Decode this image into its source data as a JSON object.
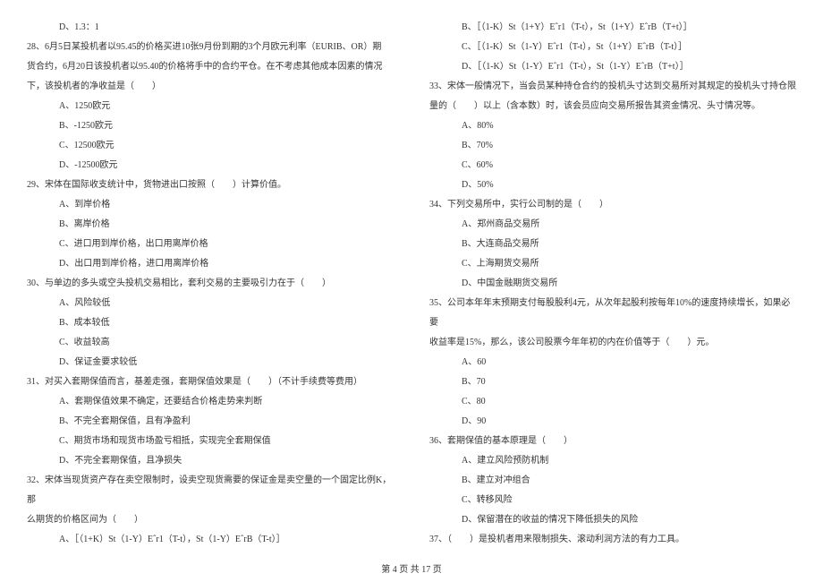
{
  "left_column": {
    "q27_d": "D、1.3：1",
    "q28_line1": "28、6月5日某投机者以95.45的价格买进10张9月份到期的3个月欧元利率（EURIB、OR）期",
    "q28_line2": "货合约，6月20日该投机者以95.40的价格将手中的合约平仓。在不考虑其他成本因素的情况",
    "q28_line3": "下，该投机者的净收益是（　　）",
    "q28_a": "A、1250欧元",
    "q28_b": "B、-1250欧元",
    "q28_c": "C、12500欧元",
    "q28_d": "D、-12500欧元",
    "q29": "29、宋体在国际收支统计中，货物进出口按照（　　）计算价值。",
    "q29_a": "A、到岸价格",
    "q29_b": "B、离岸价格",
    "q29_c": "C、进口用到岸价格，出口用离岸价格",
    "q29_d": "D、出口用到岸价格，进口用离岸价格",
    "q30": "30、与单边的多头或空头投机交易相比，套利交易的主要吸引力在于（　　）",
    "q30_a": "A、风险较低",
    "q30_b": "B、成本较低",
    "q30_c": "C、收益较高",
    "q30_d": "D、保证金要求较低",
    "q31": "31、对买入套期保值而言，基差走强，套期保值效果是（　　）（不计手续费等费用）",
    "q31_a": "A、套期保值效果不确定，还要结合价格走势来判断",
    "q31_b": "B、不完全套期保值，且有净盈利",
    "q31_c": "C、期货市场和现货市场盈亏相抵，实现完全套期保值",
    "q31_d": "D、不完全套期保值，且净损失",
    "q32_line1": "32、宋体当现货资产存在卖空限制时，设卖空现货需要的保证金是卖空量的一个固定比例K，那",
    "q32_line2": "么期货的价格区间为（　　）",
    "q32_a": "A、［（1+K）St（1-Y）Eˆr1（T-t），St（1-Y）EˆrB（T-t）］"
  },
  "right_column": {
    "q32_b": "B、［（1-K）St（1+Y）Eˆr1（T-t），St（1+Y）EˆrB（T+t）］",
    "q32_c": "C、［（1-K）St（1-Y）Eˆr1（T-t），St（1+Y）EˆrB（T-t）］",
    "q32_d": "D、［（1-K）St（1-Y）Eˆr1（T-t），St（1-Y）EˆrB（T+t）］",
    "q33_line1": "33、宋体一般情况下，当会员某种持仓合约的投机头寸达到交易所对其规定的投机头寸持仓限",
    "q33_line2": "量的（　　）以上（含本数）时，该会员应向交易所报告其资金情况、头寸情况等。",
    "q33_a": "A、80%",
    "q33_b": "B、70%",
    "q33_c": "C、60%",
    "q33_d": "D、50%",
    "q34": "34、下列交易所中，实行公司制的是（　　）",
    "q34_a": "A、郑州商品交易所",
    "q34_b": "B、大连商品交易所",
    "q34_c": "C、上海期货交易所",
    "q34_d": "D、中国金融期货交易所",
    "q35_line1": "35、公司本年年末预期支付每股股利4元，从次年起股利按每年10%的速度持续增长，如果必要",
    "q35_line2": "收益率是15%，那么，该公司股票今年年初的内在价值等于（　　）元。",
    "q35_a": "A、60",
    "q35_b": "B、70",
    "q35_c": "C、80",
    "q35_d": "D、90",
    "q36": "36、套期保值的基本原理是（　　）",
    "q36_a": "A、建立风险预防机制",
    "q36_b": "B、建立对冲组合",
    "q36_c": "C、转移风险",
    "q36_d": "D、保留潜在的收益的情况下降低损失的风险",
    "q37": "37、（　　）是投机者用来限制损失、滚动利润方法的有力工具。"
  },
  "footer": "第 4 页 共 17 页"
}
